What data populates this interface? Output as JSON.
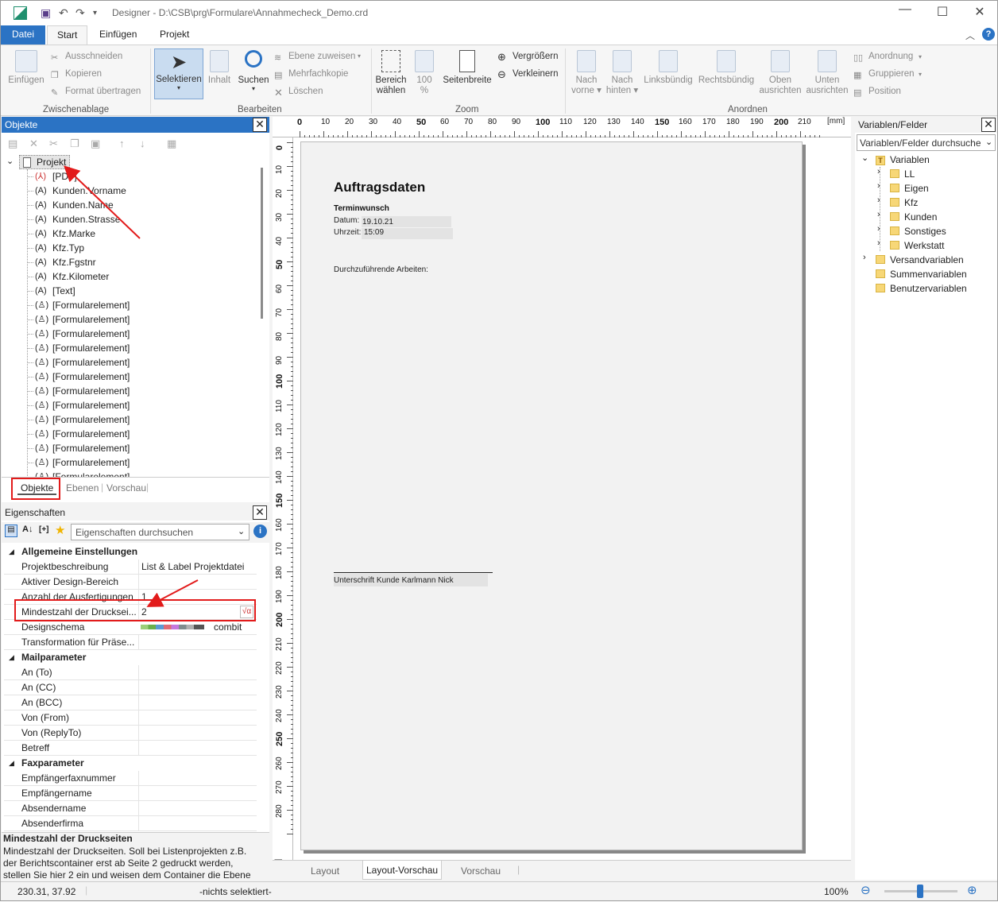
{
  "window": {
    "title": "Designer - D:\\CSB\\prg\\Formulare\\Annahmecheck_Demo.crd"
  },
  "menu": {
    "tabs": [
      "Datei",
      "Start",
      "Einfügen",
      "Projekt"
    ]
  },
  "ribbon": {
    "zwischenablage": {
      "einfuegen": "Einfügen",
      "ausschneiden": "Ausschneiden",
      "kopieren": "Kopieren",
      "format": "Format übertragen",
      "group": "Zwischenablage"
    },
    "bearbeiten": {
      "selektieren": "Selektieren",
      "inhalt": "Inhalt",
      "suchen": "Suchen",
      "ebene": "Ebene zuweisen",
      "mehrfach": "Mehrfachkopie",
      "loeschen": "Löschen",
      "group": "Bearbeiten"
    },
    "zoom": {
      "bereich1": "Bereich",
      "bereich2": "wählen",
      "p100a": "100",
      "p100b": "%",
      "seitenbreite": "Seitenbreite",
      "vergroessern": "Vergrößern",
      "verkleinern": "Verkleinern",
      "group": "Zoom"
    },
    "anordnen": {
      "nachvorne1": "Nach",
      "nachvorne2": "vorne",
      "nachhinten1": "Nach",
      "nachhinten2": "hinten",
      "links": "Linksbündig",
      "rechts": "Rechtsbündig",
      "oben1": "Oben",
      "oben2": "ausrichten",
      "unten1": "Unten",
      "unten2": "ausrichten",
      "anordnung": "Anordnung",
      "gruppieren": "Gruppieren",
      "position": "Position",
      "group": "Anordnen"
    }
  },
  "objects_panel": {
    "title": "Objekte",
    "root": "Projekt",
    "items": [
      {
        "icon": "(⅄)",
        "label": "[PDF]"
      },
      {
        "icon": "(A)",
        "label": "Kunden.Vorname"
      },
      {
        "icon": "(A)",
        "label": "Kunden.Name"
      },
      {
        "icon": "(A)",
        "label": "Kunden.Strasse"
      },
      {
        "icon": "(A)",
        "label": "Kfz.Marke"
      },
      {
        "icon": "(A)",
        "label": "Kfz.Typ"
      },
      {
        "icon": "(A)",
        "label": "Kfz.Fgstnr"
      },
      {
        "icon": "(A)",
        "label": "Kfz.Kilometer"
      },
      {
        "icon": "(A)",
        "label": "[Text]"
      },
      {
        "icon": "(♙)",
        "label": "[Formularelement]"
      },
      {
        "icon": "(♙)",
        "label": "[Formularelement]"
      },
      {
        "icon": "(♙)",
        "label": "[Formularelement]"
      },
      {
        "icon": "(♙)",
        "label": "[Formularelement]"
      },
      {
        "icon": "(♙)",
        "label": "[Formularelement]"
      },
      {
        "icon": "(♙)",
        "label": "[Formularelement]"
      },
      {
        "icon": "(♙)",
        "label": "[Formularelement]"
      },
      {
        "icon": "(♙)",
        "label": "[Formularelement]"
      },
      {
        "icon": "(♙)",
        "label": "[Formularelement]"
      },
      {
        "icon": "(♙)",
        "label": "[Formularelement]"
      },
      {
        "icon": "(♙)",
        "label": "[Formularelement]"
      },
      {
        "icon": "(♙)",
        "label": "[Formularelement]"
      },
      {
        "icon": "(♙)",
        "label": "[Formularelement]"
      }
    ],
    "tabs": [
      "Objekte",
      "Ebenen",
      "Vorschau"
    ]
  },
  "properties": {
    "title": "Eigenschaften",
    "search_placeholder": "Eigenschaften durchsuchen",
    "sort_label": "[+]",
    "cat_general": "Allgemeine Einstellungen",
    "cat_mail": "Mailparameter",
    "cat_fax": "Faxparameter",
    "rows": {
      "projektbeschreibung": {
        "name": "Projektbeschreibung",
        "value": "List & Label Projektdatei"
      },
      "design_bereich": {
        "name": "Aktiver Design-Bereich",
        "value": ""
      },
      "anzahl": {
        "name": "Anzahl der Ausfertigungen",
        "value": "1"
      },
      "mindestzahl": {
        "name": "Mindestzahl der Drucksei...",
        "value": "2"
      },
      "designschema": {
        "name": "Designschema",
        "value": "combit"
      },
      "transformation": {
        "name": "Transformation für Präse...",
        "value": ""
      },
      "an_to": {
        "name": "An (To)",
        "value": ""
      },
      "an_cc": {
        "name": "An (CC)",
        "value": ""
      },
      "an_bcc": {
        "name": "An (BCC)",
        "value": ""
      },
      "von_from": {
        "name": "Von (From)",
        "value": ""
      },
      "von_reply": {
        "name": "Von (ReplyTo)",
        "value": ""
      },
      "betreff": {
        "name": "Betreff",
        "value": ""
      },
      "faxnummer": {
        "name": "Empfängerfaxnummer",
        "value": ""
      },
      "empfaenger": {
        "name": "Empfängername",
        "value": ""
      },
      "absendername": {
        "name": "Absendername",
        "value": ""
      },
      "absenderfirma": {
        "name": "Absenderfirma",
        "value": ""
      }
    },
    "description_title": "Mindestzahl der Druckseiten",
    "description_text": "Mindestzahl der Druckseiten. Soll bei Listenprojekten z.B. der Berichtscontainer erst ab Seite 2 gedruckt werden, stellen Sie hier 2 ein und weisen dem Container die Ebene 'Folgeseiten'"
  },
  "ruler": {
    "unit": "[mm]",
    "h_labels": [
      "0",
      "10",
      "20",
      "30",
      "40",
      "50",
      "60",
      "70",
      "80",
      "90",
      "100",
      "110",
      "120",
      "130",
      "140",
      "150",
      "160",
      "170",
      "180",
      "190",
      "200",
      "210"
    ],
    "v_labels": [
      "0",
      "10",
      "20",
      "30",
      "40",
      "50",
      "60",
      "70",
      "80",
      "90",
      "100",
      "110",
      "120",
      "130",
      "140",
      "150",
      "160",
      "170",
      "180",
      "190",
      "200",
      "210",
      "220",
      "230",
      "240",
      "250",
      "260",
      "270",
      "280"
    ]
  },
  "document": {
    "heading": "Auftragsdaten",
    "termin": "Terminwunsch",
    "datum_label": "Datum:",
    "datum_value": "19.10.21",
    "uhrzeit_label": "Uhrzeit:",
    "uhrzeit_value": "15:09",
    "arbeiten": "Durchzuführende Arbeiten:",
    "unterschrift": "Unterschrift Kunde Karlmann Nick"
  },
  "editor_tabs": [
    "Layout",
    "Layout-Vorschau",
    "Vorschau"
  ],
  "variables_panel": {
    "title": "Variablen/Felder",
    "search_placeholder": "Variablen/Felder durchsuche",
    "root": "Variablen",
    "children": [
      "LL",
      "Eigen",
      "Kfz",
      "Kunden",
      "Sonstiges",
      "Werkstatt"
    ],
    "versand": "Versandvariablen",
    "summen": "Summenvariablen",
    "benutzer": "Benutzervariablen"
  },
  "statusbar": {
    "coords": "230.31, 37.92",
    "selection": "-nichts selektiert-",
    "zoom": "100%"
  },
  "colors": {
    "accent": "#2b73c4",
    "annotation": "#e21b1b",
    "panel_header": "#2b73c4"
  }
}
